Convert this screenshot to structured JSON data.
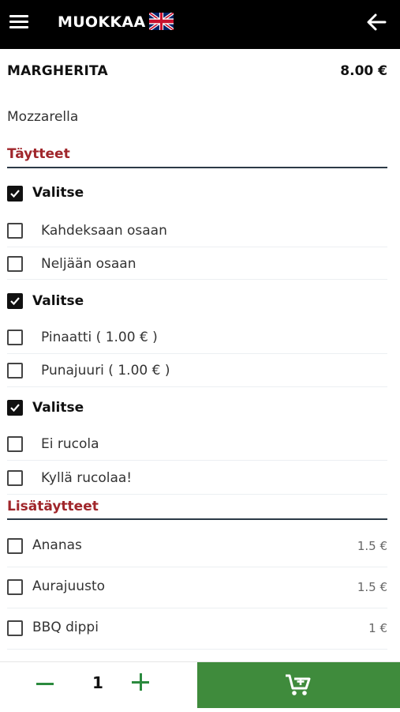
{
  "header": {
    "title": "MUOKKAA",
    "menu_icon": "hamburger-menu-icon",
    "flag_icon": "uk-flag-icon",
    "back_icon": "arrow-left-icon"
  },
  "product": {
    "name": "MARGHERITA",
    "price": "8.00 €",
    "description": "Mozzarella"
  },
  "sections": {
    "taytteet": "Täytteet",
    "lisataytteet": "Lisätäytteet"
  },
  "groups": [
    {
      "label": "Valitse",
      "checked": true,
      "options": [
        {
          "label": "Kahdeksaan osaan",
          "checked": false
        },
        {
          "label": "Neljään osaan",
          "checked": false
        }
      ]
    },
    {
      "label": "Valitse",
      "checked": true,
      "options": [
        {
          "label": "Pinaatti ( 1.00 € )",
          "checked": false
        },
        {
          "label": "Punajuuri ( 1.00 € )",
          "checked": false
        }
      ]
    },
    {
      "label": "Valitse",
      "checked": true,
      "options": [
        {
          "label": "Ei rucola",
          "checked": false
        },
        {
          "label": "Kyllä rucolaa!",
          "checked": false
        }
      ]
    }
  ],
  "extras": [
    {
      "label": "Ananas",
      "price": "1.5 €",
      "checked": false
    },
    {
      "label": "Aurajuusto",
      "price": "1.5 €",
      "checked": false
    },
    {
      "label": "BBQ dippi",
      "price": "1 €",
      "checked": false
    }
  ],
  "footer": {
    "quantity": "1",
    "minus_icon": "minus-icon",
    "plus_icon": "plus-icon",
    "cart_icon": "add-to-cart-icon"
  },
  "colors": {
    "header_bg": "#000000",
    "section_title": "#a0262b",
    "accent_green": "#3f8b3c",
    "stepper_green": "#2b8a3e"
  }
}
